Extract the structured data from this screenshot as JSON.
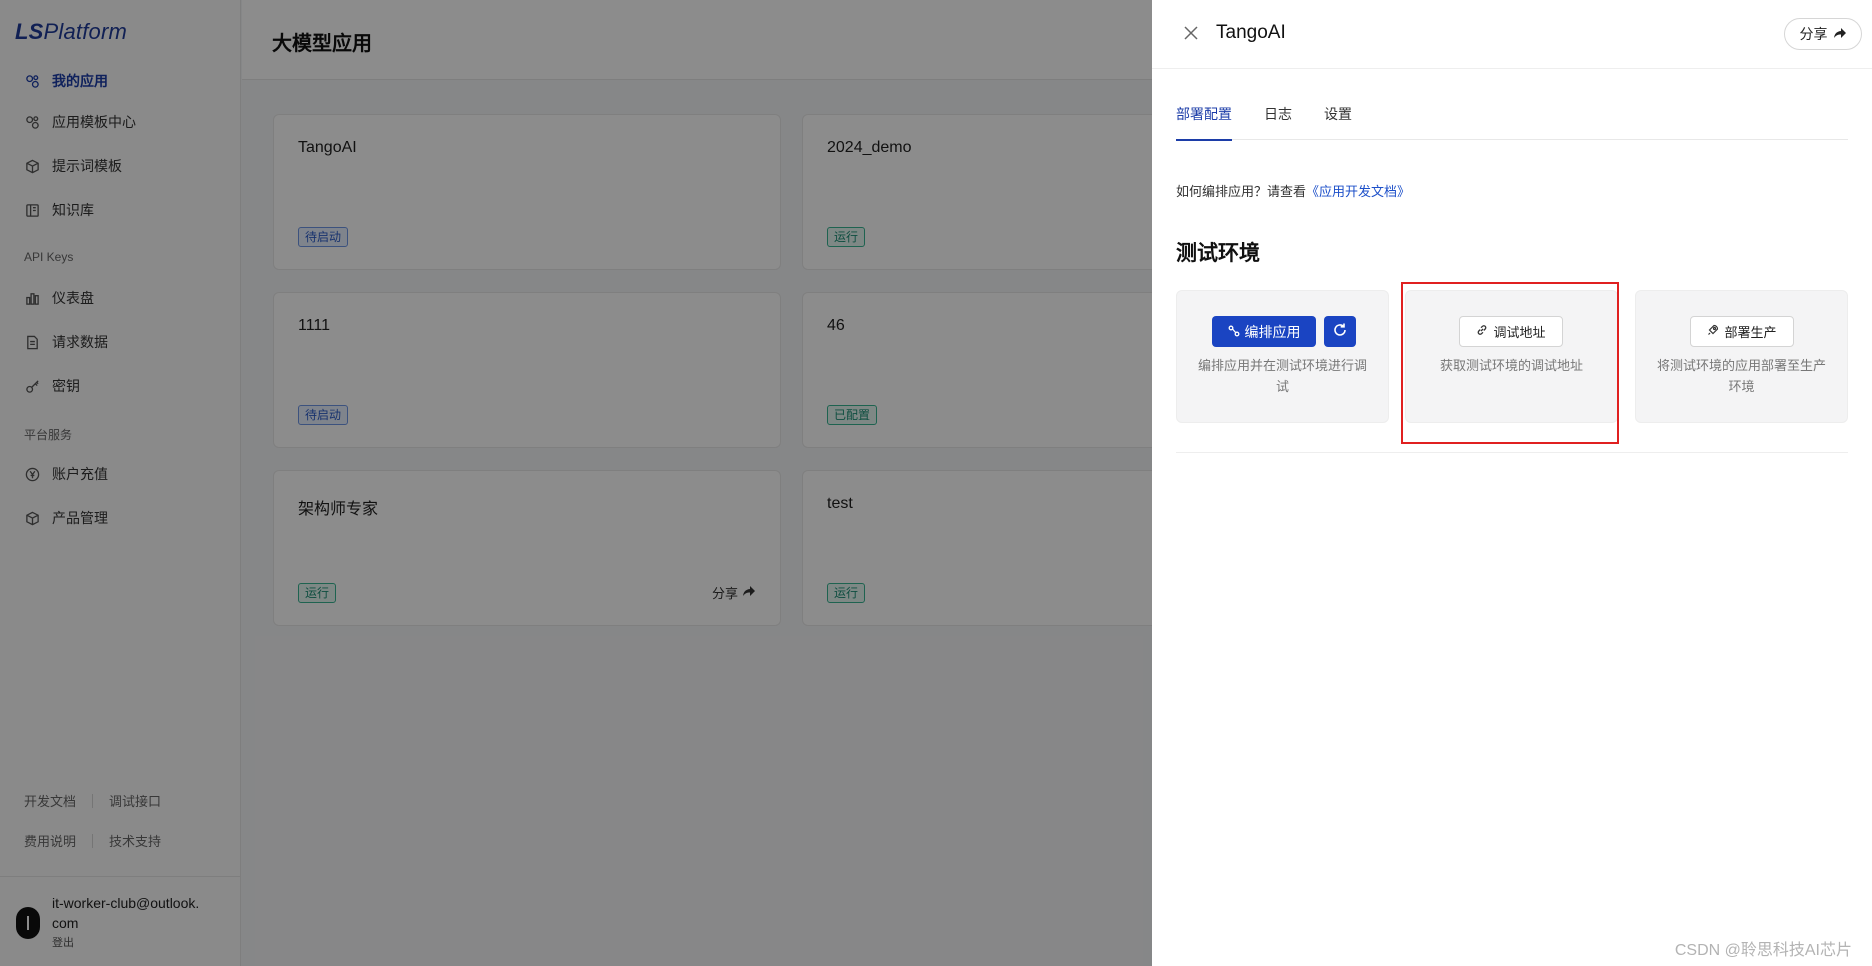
{
  "sidebar": {
    "logo": {
      "prefix": "LS",
      "rest": "Platform"
    },
    "items": [
      {
        "label": "我的应用",
        "icon": "apps-icon"
      },
      {
        "label": "应用模板中心",
        "icon": "template-icon"
      },
      {
        "label": "提示词模板",
        "icon": "cube-icon"
      },
      {
        "label": "知识库",
        "icon": "book-icon"
      }
    ],
    "group_api": "API Keys",
    "api_items": [
      {
        "label": "仪表盘",
        "icon": "bar-chart-icon"
      },
      {
        "label": "请求数据",
        "icon": "file-icon"
      },
      {
        "label": "密钥",
        "icon": "key-icon"
      }
    ],
    "group_platform": "平台服务",
    "platform_items": [
      {
        "label": "账户充值",
        "icon": "yuan-icon"
      },
      {
        "label": "产品管理",
        "icon": "cube-icon"
      }
    ],
    "footer_links": [
      "开发文档",
      "调试接口",
      "费用说明",
      "技术支持"
    ],
    "user": {
      "email": "it-worker-club@outlook.com",
      "logout": "登出"
    }
  },
  "main": {
    "title": "大模型应用",
    "apps": [
      {
        "name": "TangoAI",
        "status": "待启动"
      },
      {
        "name": "2024_demo",
        "status": "运行"
      },
      {
        "name": "1111",
        "status": "待启动"
      },
      {
        "name": "46",
        "status": "已配置"
      },
      {
        "name": "架构师专家",
        "status": "运行",
        "share": "分享"
      },
      {
        "name": "test",
        "status": "运行"
      }
    ]
  },
  "drawer": {
    "title": "TangoAI",
    "share_label": "分享",
    "tabs": [
      "部署配置",
      "日志",
      "设置"
    ],
    "hint_text": "如何编排应用？请查看",
    "hint_link": "《应用开发文档》",
    "section_title": "测试环境",
    "cards": [
      {
        "button": "编排应用",
        "desc": "编排应用并在测试环境进行调试"
      },
      {
        "button": "调试地址",
        "desc": "获取测试环境的调试地址"
      },
      {
        "button": "部署生产",
        "desc": "将测试环境的应用部署至生产环境"
      }
    ]
  },
  "watermark": "CSDN @聆思科技AI芯片",
  "colors": {
    "primary": "#1a44c2",
    "highlight": "#e02020",
    "badge_pending": "#2b5cc9",
    "badge_running": "#1b8f76"
  }
}
